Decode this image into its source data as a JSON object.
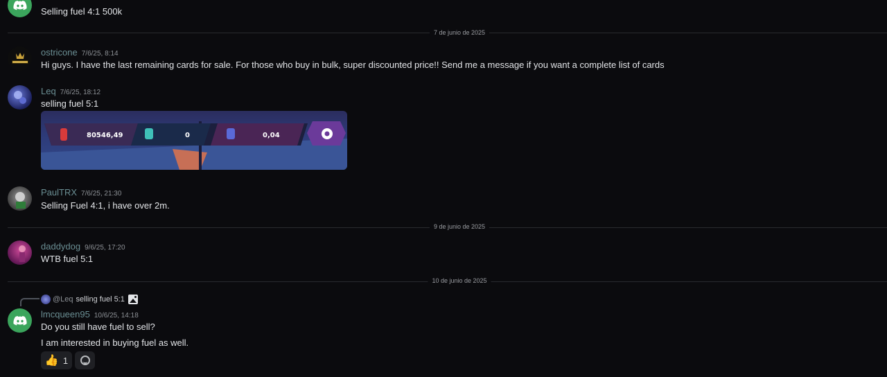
{
  "messages": [
    {
      "username": "",
      "timestamp": "",
      "text": "Selling fuel 4:1   500k"
    },
    {
      "username": "ostricone",
      "timestamp": "7/6/25, 8:14",
      "text": "Hi guys. I have the last remaining cards for sale. For those who buy in bulk, super discounted price!! Send me a message if you want a complete list of cards"
    },
    {
      "username": "Leq",
      "timestamp": "7/6/25, 18:12",
      "text": "selling fuel 5:1"
    },
    {
      "username": "PaulTRX",
      "timestamp": "7/6/25, 21:30",
      "text": "Selling Fuel 4:1, i have over 2m."
    },
    {
      "username": "daddydog",
      "timestamp": "9/6/25, 17:20",
      "text": "WTB fuel 5:1"
    },
    {
      "username": "lmcqueen95",
      "timestamp": "10/6/25, 14:18",
      "text": "Do you still have fuel to sell?",
      "text2": "I am interested in buying fuel as well."
    }
  ],
  "dividers": [
    "7 de junio de 2025",
    "9 de junio de 2025",
    "10 de junio de 2025"
  ],
  "embed": {
    "value1": "80546,49",
    "value2": "0",
    "value3": "0,04"
  },
  "reply": {
    "mention": "@Leq",
    "text": "selling fuel 5:1"
  },
  "reactions": {
    "thumbs_count": "1"
  },
  "colors": {
    "background": "#0b0b0e",
    "username": "#6b8f94",
    "discord_green": "#3ba55c"
  }
}
